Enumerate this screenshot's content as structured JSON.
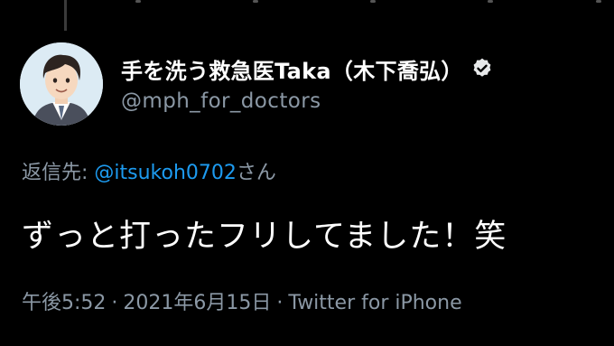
{
  "tweet": {
    "author": {
      "display_name": "手を洗う救急医Taka（木下喬弘）",
      "handle": "@mph_for_doctors",
      "verified": true
    },
    "reply_prefix": "返信先: ",
    "reply_mention": "@itsukoh0702",
    "reply_suffix": "さん",
    "text": "ずっと打ったフリしてました！笑",
    "time": "午後5:52",
    "separator": "·",
    "date": "2021年6月15日",
    "source": "Twitter for iPhone"
  },
  "colors": {
    "background": "#000000",
    "primary_text": "#ffffff",
    "secondary_text": "#8b98a5",
    "link": "#1d9bf0"
  }
}
